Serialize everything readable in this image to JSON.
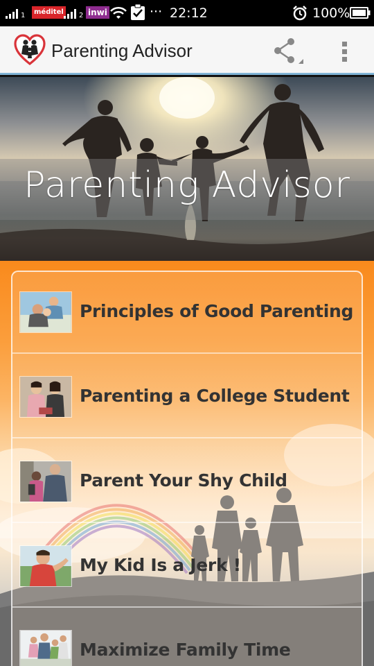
{
  "status_bar": {
    "carrier_1": "méditel",
    "sim_2": "2",
    "carrier_2": "inwi",
    "more": "···",
    "time": "22:12",
    "battery": "100%"
  },
  "app_bar": {
    "title": "Parenting Advisor"
  },
  "hero": {
    "title": "Parenting Advisor"
  },
  "list": [
    {
      "label": "Principles of Good Parenting"
    },
    {
      "label": "Parenting a College Student"
    },
    {
      "label": "Parent Your Shy Child"
    },
    {
      "label": "My Kid Is a Jerk !"
    },
    {
      "label": "Maximize Family Time"
    }
  ],
  "colors": {
    "accent_orange": "#f98a1c",
    "app_bar_underline": "#7fb3d5",
    "logo_red": "#d9343a",
    "carrier_1_bg": "#d9252a",
    "carrier_2_bg": "#8e2c8f"
  }
}
